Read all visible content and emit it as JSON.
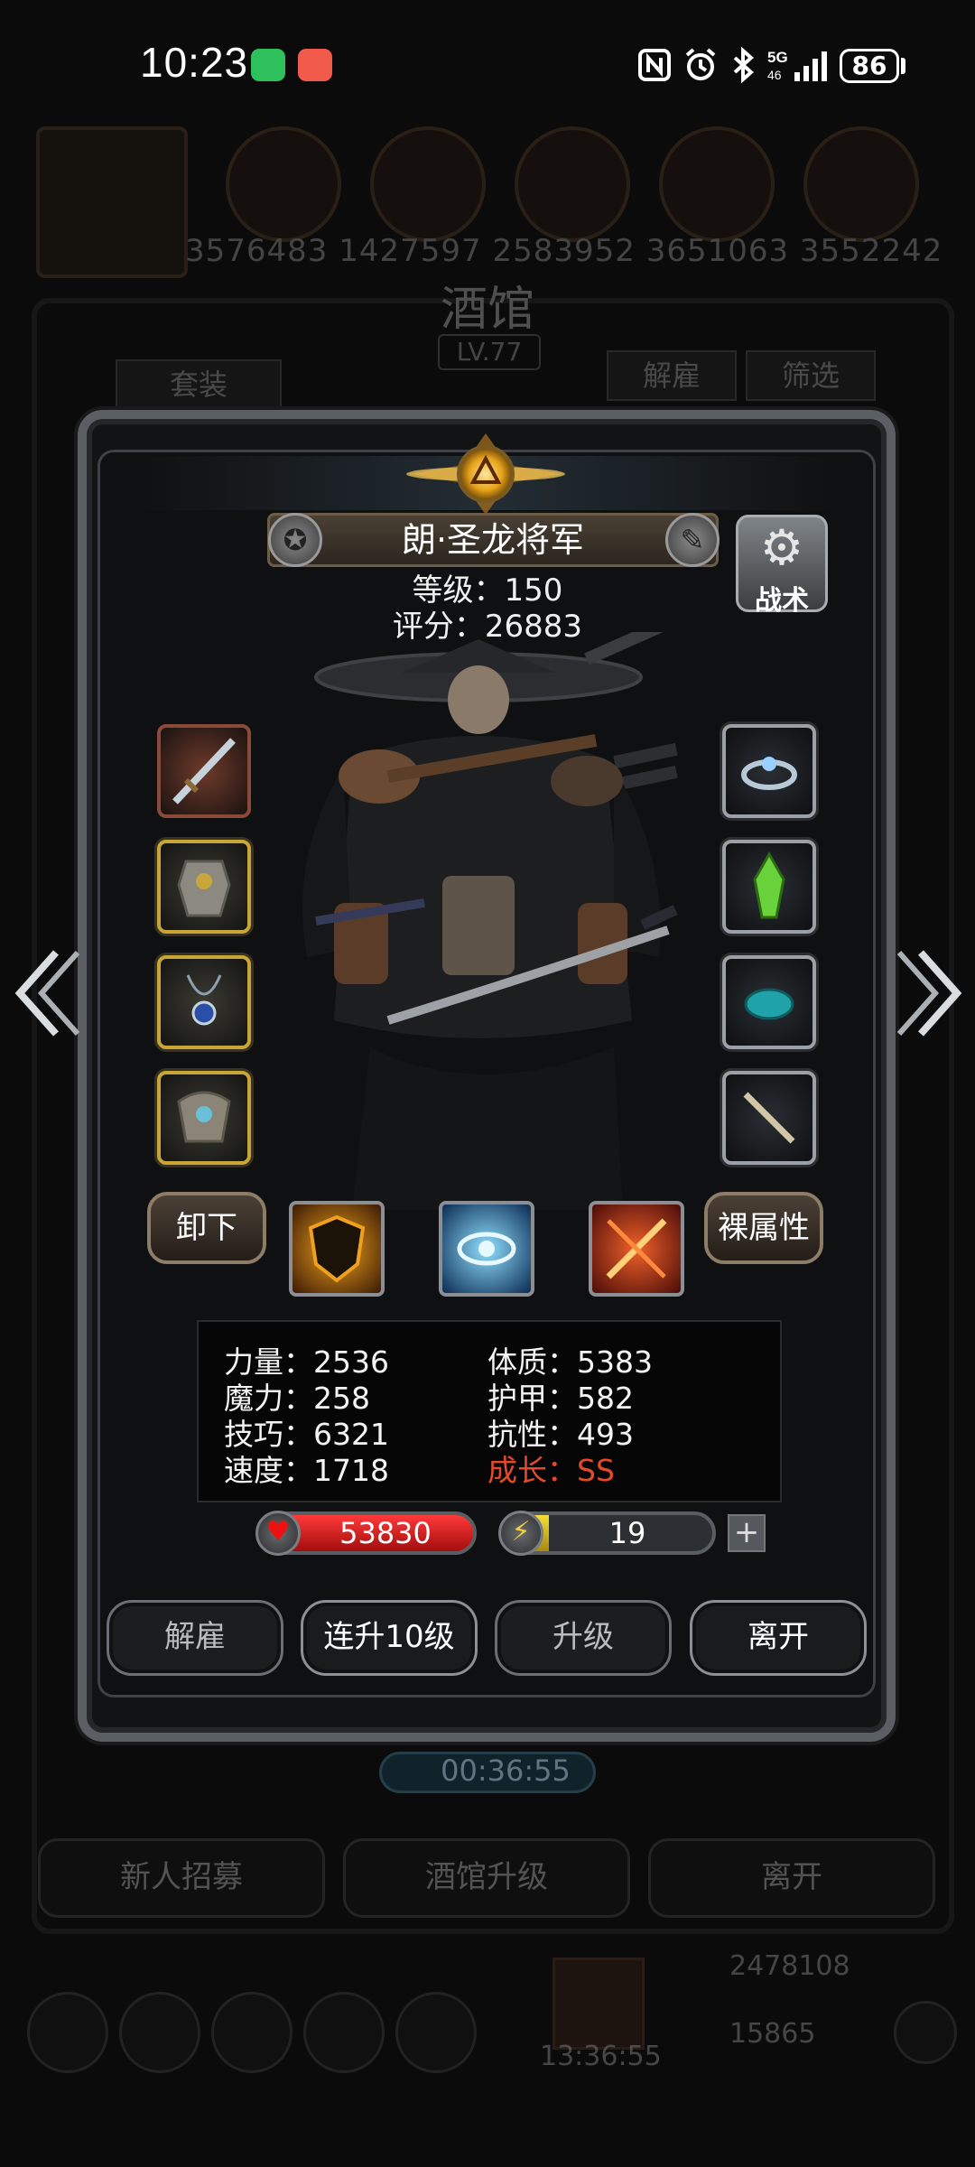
{
  "status_bar": {
    "time": "10:23",
    "battery": "86",
    "icons": [
      "wechat-icon",
      "app-icon",
      "nfc-icon",
      "alarm-icon",
      "bluetooth-icon",
      "signal-5g-icon"
    ]
  },
  "background": {
    "player_ids": "3576483  1427597  2583952  3651063  3552242",
    "title": "酒馆",
    "level": "LV.77",
    "left_button": "套装",
    "right_buttons": [
      "解雇",
      "筛选"
    ],
    "timer": "00:36:55",
    "bottom_buttons": [
      "新人招募",
      "酒馆升级",
      "离开"
    ],
    "resource_gold": "2478108",
    "resource_gem": "15865",
    "clock": "13:36:55"
  },
  "hero": {
    "name": "朗·圣龙将军",
    "level_text": "等级：150",
    "score_text": "评分：26883",
    "tactics_label": "战术"
  },
  "actions": {
    "unequip": "卸下",
    "bare_attributes": "裸属性"
  },
  "stats": {
    "strength": "力量：2536",
    "magic": "魔力：258",
    "skill": "技巧：6321",
    "speed": "速度：1718",
    "constitution": "体质：5383",
    "armor": "护甲：582",
    "resistance": "抗性：493",
    "growth": "成长：SS"
  },
  "vitals": {
    "hp": "53830",
    "energy": "19",
    "energy_fill": 0.22
  },
  "dialog_buttons": {
    "dismiss": "解雇",
    "level_up_10": "连升10级",
    "level_up": "升级",
    "leave": "离开"
  },
  "colors": {
    "growth_red": "#e24a2a",
    "hp_red": "#d21818",
    "energy_yellow": "#f0d02c",
    "gold_frame": "#c8a53a"
  }
}
